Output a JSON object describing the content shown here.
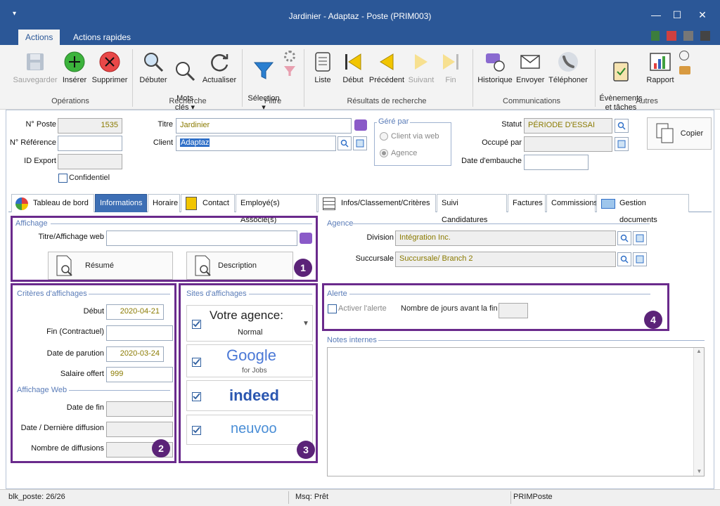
{
  "window": {
    "title": "Jardinier - Adaptaz - Poste (PRIM003)"
  },
  "ribbon": {
    "tabs": [
      "Actions",
      "Actions rapides"
    ],
    "buttons": {
      "save": "Sauvegarder",
      "insert": "Insérer",
      "delete": "Supprimer",
      "start": "Débuter",
      "keywords": "Mots\nclés ▾",
      "refresh": "Actualiser",
      "selection": "Sélection\n▾",
      "list": "Liste",
      "first": "Début",
      "previous": "Précédent",
      "next": "Suivant",
      "last": "Fin",
      "history": "Historique",
      "send": "Envoyer",
      "phone": "Téléphoner",
      "events": "Évènements\net tâches",
      "report": "Rapport"
    },
    "groups": {
      "operations": "Opérations",
      "search": "Recherche",
      "filter": "Filtre",
      "results": "Résultats de recherche",
      "communications": "Communications",
      "others": "Autres"
    }
  },
  "header": {
    "poste_label": "N° Poste",
    "poste_value": "1535",
    "reference_label": "N° Référence",
    "reference_value": "",
    "idexport_label": "ID Export",
    "idexport_value": "",
    "confidential_label": "Confidentiel",
    "titre_label": "Titre",
    "titre_value": "Jardinier",
    "client_label": "Client",
    "client_value": "Adaptaz",
    "gere_par_label": "Géré par",
    "gere_options": [
      "Client via web",
      "Agence"
    ],
    "statut_label": "Statut",
    "statut_value": "PÉRIODE D'ESSAI",
    "occupe_label": "Occupé par",
    "occupe_value": "",
    "embauche_label": "Date d'embauche",
    "embauche_value": "",
    "copy_label": "Copier"
  },
  "tabs": [
    "Tableau de bord",
    "Informations",
    "Horaire",
    "Contact",
    "Employé(s) Associé(s)",
    "Infos/Classement/Critères",
    "Suivi Candidatures",
    "Factures",
    "Commissions",
    "Gestion documents"
  ],
  "affichage": {
    "section": "Affichage",
    "titre_web_label": "Titre/Affichage web",
    "titre_web_value": "",
    "resume_label": "Résumé",
    "description_label": "Description"
  },
  "criteres": {
    "section": "Critères d'affichages",
    "debut_label": "Début",
    "debut_value": "2020-04-21",
    "fin_label": "Fin (Contractuel)",
    "fin_value": "",
    "parution_label": "Date de parution",
    "parution_value": "2020-03-24",
    "salaire_label": "Salaire offert",
    "salaire_value": "999",
    "web_section": "Affichage Web",
    "datefin_label": "Date de fin",
    "datefin_value": "",
    "derniere_label": "Date / Dernière diffusion",
    "derniere_value": "",
    "nombre_label": "Nombre de diffusions",
    "nombre_value": ""
  },
  "sites": {
    "section": "Sites d'affichages",
    "agence_title": "Votre agence:",
    "agence_sub": "Normal",
    "google": "Google",
    "google_sub": "for Jobs",
    "indeed": "indeed",
    "neuvoo": "neuvoo"
  },
  "agence": {
    "section": "Agence",
    "division_label": "Division",
    "division_value": "Intégration Inc.",
    "succursale_label": "Succursale",
    "succursale_value": "Succursale/ Branch 2"
  },
  "alerte": {
    "section": "Alerte",
    "activer_label": "Activer l'alerte",
    "jours_label": "Nombre de jours avant la fin",
    "jours_value": ""
  },
  "notes": {
    "section": "Notes internes"
  },
  "badges": [
    "1",
    "2",
    "3",
    "4"
  ],
  "status": {
    "left": "blk_poste: 26/26",
    "mid": "Msq: Prêt",
    "right": "PRIMPoste"
  },
  "colors": {
    "titlebar": "#2b5797",
    "highlight": "#6a2a8c",
    "readonly_text": "#8a7a00"
  }
}
